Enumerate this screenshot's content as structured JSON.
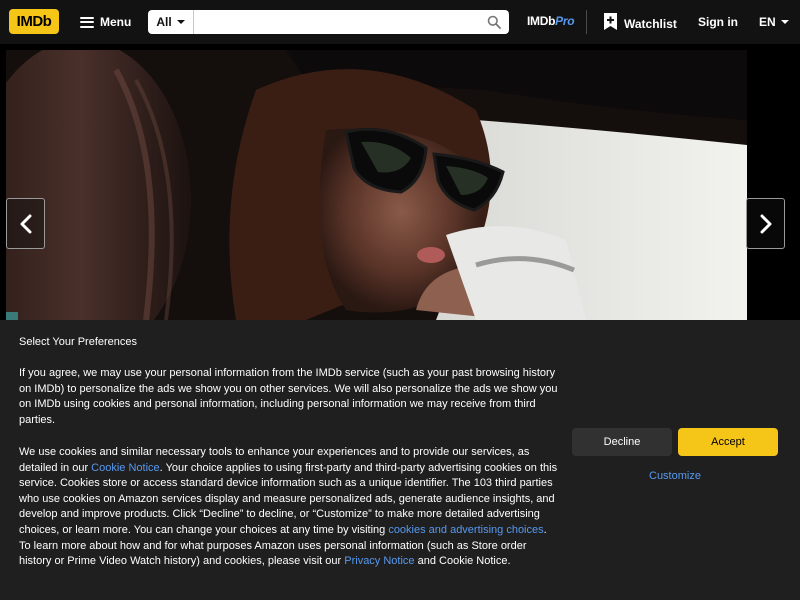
{
  "header": {
    "logo": "IMDb",
    "menu_label": "Menu",
    "search_category": "All",
    "search_placeholder": "",
    "imdbpro_text": "IMDb",
    "imdbpro_pro": "Pro",
    "watchlist_label": "Watchlist",
    "signin_label": "Sign in",
    "language": "EN"
  },
  "colors": {
    "brand": "#f5c518",
    "header_bg": "#121212",
    "link": "#5799ef",
    "consent_bg": "#1f1f1f"
  },
  "hero": {
    "image_description_icon": "video-still",
    "prev_icon": "chevron-left-icon",
    "next_icon": "chevron-right-icon"
  },
  "consent": {
    "title": "Select Your Preferences",
    "paragraph1": "If you agree, we may use your personal information from the IMDb service (such as your past browsing history on IMDb) to personalize the ads we show you on other services. We will also personalize the ads we show you on IMDb using cookies and personal information, including personal information we may receive from third parties.",
    "p2_a": "We use cookies and similar necessary tools to enhance your experiences and to provide our services, as detailed in our ",
    "p2_link1": "Cookie Notice",
    "p2_b": ". Your choice applies to using first-party and third-party advertising cookies on this service. Cookies store or access standard device information such as a unique identifier. The 103 third parties who use cookies on Amazon services display and measure personalized ads, generate audience insights, and develop and improve products. Click “Decline” to decline, or “Customize” to make more detailed advertising choices, or learn more. You can change your choices at any time by visiting ",
    "p2_link2": "cookies and advertising choices",
    "p2_c": ". To learn more about how and for what purposes Amazon uses personal information (such as Store order history or Prime Video Watch history) and cookies, please visit our ",
    "p2_link3": "Privacy Notice",
    "p2_d": " and Cookie Notice.",
    "decline_label": "Decline",
    "accept_label": "Accept",
    "customize_label": "Customize"
  }
}
